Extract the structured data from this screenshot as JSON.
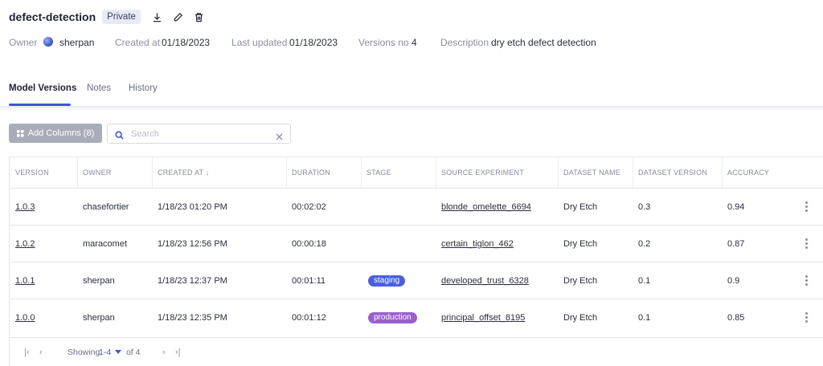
{
  "model": {
    "name": "defect-detection",
    "visibility": "Private",
    "icons": [
      "download-icon",
      "edit-icon",
      "delete-icon"
    ]
  },
  "meta": {
    "owner_label": "Owner",
    "owner": "sherpan",
    "created_label": "Created at",
    "created": "01/18/2023",
    "updated_label": "Last updated",
    "updated": "01/18/2023",
    "versions_label": "Versions no",
    "versions": "4",
    "description_label": "Description",
    "description": "dry etch defect detection"
  },
  "tabs": [
    {
      "label": "Model Versions",
      "active": true
    },
    {
      "label": "Notes",
      "active": false
    },
    {
      "label": "History",
      "active": false
    }
  ],
  "toolbar": {
    "add_columns_label": "Add Columns (8)",
    "search_placeholder": "Search",
    "search_value": ""
  },
  "table": {
    "headers": [
      "VERSION",
      "OWNER",
      "CREATED AT",
      "DURATION",
      "STAGE",
      "SOURCE EXPERIMENT",
      "DATASET NAME",
      "DATASET VERSION",
      "ACCURACY"
    ],
    "sort_indicator": "↓",
    "rows": [
      {
        "version": "1.0.3",
        "owner": "chasefortier",
        "created": "1/18/23 01:20 PM",
        "duration": "00:02:02",
        "stage": "",
        "experiment": "blonde_omelette_6694",
        "dataset": "Dry Etch",
        "dataset_version": "0.3",
        "accuracy": "0.94"
      },
      {
        "version": "1.0.2",
        "owner": "maracomet",
        "created": "1/18/23 12:56 PM",
        "duration": "00:00:18",
        "stage": "",
        "experiment": "certain_tiglon_462",
        "dataset": "Dry Etch",
        "dataset_version": "0.2",
        "accuracy": "0.87"
      },
      {
        "version": "1.0.1",
        "owner": "sherpan",
        "created": "1/18/23 12:37 PM",
        "duration": "00:01:11",
        "stage": "staging",
        "experiment": "developed_trust_6328",
        "dataset": "Dry Etch",
        "dataset_version": "0.1",
        "accuracy": "0.9"
      },
      {
        "version": "1.0.0",
        "owner": "sherpan",
        "created": "1/18/23 12:35 PM",
        "duration": "00:01:12",
        "stage": "production",
        "experiment": "principal_offset_8195",
        "dataset": "Dry Etch",
        "dataset_version": "0.1",
        "accuracy": "0.85"
      }
    ]
  },
  "stage_colors": {
    "staging": "#4a5fe0",
    "production": "#9a5fcf"
  },
  "pagination": {
    "showing_label": "Showing",
    "range": "1-4",
    "of_label": "of 4"
  },
  "colors": {
    "accent": "#3e56d6",
    "button_disabled": "#a9adb9"
  }
}
